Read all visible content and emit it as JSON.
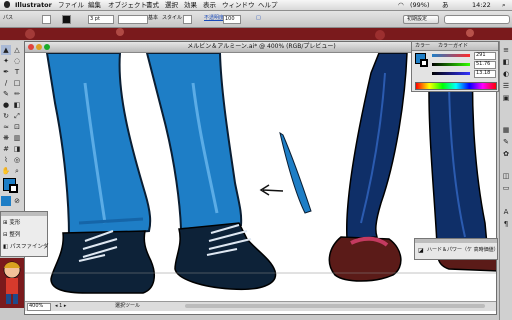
{
  "menubar": {
    "apple": "",
    "app_name": "Illustrator",
    "items": [
      "ファイル",
      "編集",
      "オブジェクト",
      "書式",
      "選択",
      "効果",
      "表示",
      "ウィンドウ",
      "ヘルプ"
    ],
    "battery": "(99%)",
    "ime": "あ",
    "clock": "14:22"
  },
  "controlbar": {
    "selection_label": "パス",
    "stroke_weight": "3 pt",
    "brush_label": "基本",
    "style_label": "スタイル",
    "opacity_label": "不透明度",
    "opacity_value": "100",
    "workspace_button": "初期設定"
  },
  "document": {
    "title": "メルビン＆アルミーン.ai* @ 400% (RGB/プレビュー)",
    "zoom": "400%",
    "status_text": "選択ツール"
  },
  "color_panel": {
    "tab_color": "カラー",
    "tab_guide": "カラーガイド",
    "r_value": "291",
    "g_value": "51.76",
    "b_value": "13.18"
  },
  "path_panel": {
    "items": [
      "変形",
      "整列",
      "パスファインダ"
    ]
  },
  "brush_panel": {
    "label": "ハード＆パワー（ケ 高時価値）"
  },
  "colors": {
    "left_pants": "#1e7ec6",
    "right_pants": "#0f2f68",
    "left_shoes": "#0d2238",
    "right_shoes": "#5b1b18",
    "accent": "#8b1a1d"
  }
}
